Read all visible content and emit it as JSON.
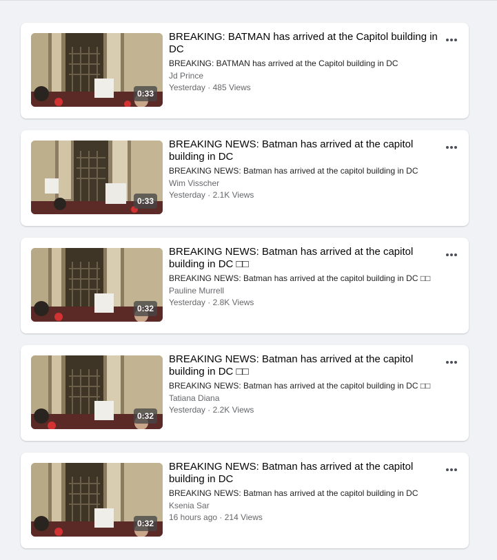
{
  "videos": [
    {
      "title": "BREAKING: BATMAN has arrived at the Capitol building in DC",
      "description": "BREAKING: BATMAN has arrived at the Capitol building in DC",
      "author": "Jd Prince",
      "posted": "Yesterday",
      "views": "485 Views",
      "duration": "0:33"
    },
    {
      "title": "BREAKING NEWS: Batman has arrived at the capitol building in DC",
      "description": "BREAKING NEWS: Batman has arrived at the capitol building in DC",
      "author": "Wim Visscher",
      "posted": "Yesterday",
      "views": "2.1K Views",
      "duration": "0:33"
    },
    {
      "title": "BREAKING NEWS: Batman has arrived at the capitol building in DC □□",
      "description": "BREAKING NEWS: Batman has arrived at the capitol building in DC □□",
      "author": "Pauline Murrell",
      "posted": "Yesterday",
      "views": "2.8K Views",
      "duration": "0:32"
    },
    {
      "title": "BREAKING NEWS: Batman has arrived at the capitol building in DC □□",
      "description": "BREAKING NEWS: Batman has arrived at the capitol building in DC □□",
      "author": "Tatiana Diana",
      "posted": "Yesterday",
      "views": "2.2K Views",
      "duration": "0:32"
    },
    {
      "title": "BREAKING NEWS: Batman has arrived at the capitol building in DC",
      "description": "BREAKING NEWS: Batman has arrived at the capitol building in DC",
      "author": "Ksenia Sar",
      "posted": "16 hours ago",
      "views": "214 Views",
      "duration": "0:32"
    }
  ],
  "meta_separator": " · ",
  "icons": {
    "more": "more-options-icon"
  }
}
